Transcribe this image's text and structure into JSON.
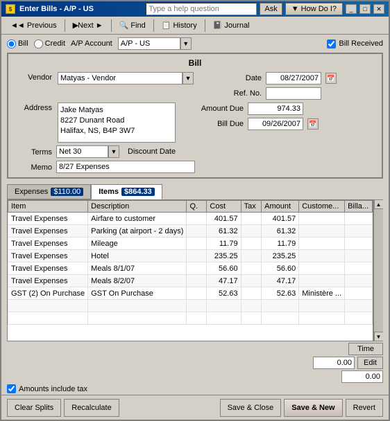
{
  "window": {
    "title": "Enter Bills - A/P - US",
    "help_placeholder": "Type a help question",
    "ask_label": "Ask",
    "howdo_label": "▼ How Do I?"
  },
  "toolbar": {
    "previous_label": "◄ Previous",
    "next_label": "Next ►",
    "find_label": "🔍 Find",
    "history_label": "History",
    "journal_label": "Journal"
  },
  "form": {
    "bill_radio": "Bill",
    "credit_radio": "Credit",
    "ap_account_label": "A/P Account",
    "ap_account_value": "A/P - US",
    "bill_received_label": "Bill Received",
    "section_title": "Bill",
    "vendor_label": "Vendor",
    "vendor_value": "Matyas - Vendor",
    "address_label": "Address",
    "address_line1": "Jake Matyas",
    "address_line2": "8227 Dunant Road",
    "address_line3": "Halifax, NS, B4P 3W7",
    "date_label": "Date",
    "date_value": "08/27/2007",
    "refno_label": "Ref. No.",
    "refno_value": "",
    "amount_due_label": "Amount Due",
    "amount_due_value": "974.33",
    "bill_due_label": "Bill Due",
    "bill_due_value": "09/26/2007",
    "terms_label": "Terms",
    "terms_value": "Net 30",
    "discount_date_label": "Discount Date",
    "memo_label": "Memo",
    "memo_value": "8/27 Expenses"
  },
  "tabs": [
    {
      "label": "Expenses",
      "amount": "$110.00",
      "active": false
    },
    {
      "label": "Items",
      "amount": "$864.33",
      "active": true
    }
  ],
  "table": {
    "headers": [
      "Item",
      "Description",
      "Q.",
      "Cost",
      "Tax",
      "Amount",
      "Custome...",
      "Billa..."
    ],
    "rows": [
      {
        "item": "Travel Expenses",
        "desc": "Airfare to customer",
        "qty": "",
        "cost": "401.57",
        "tax": "",
        "amount": "401.57",
        "customer": "",
        "billable": ""
      },
      {
        "item": "Travel Expenses",
        "desc": "Parking (at airport - 2 days)",
        "qty": "",
        "cost": "61.32",
        "tax": "",
        "amount": "61.32",
        "customer": "",
        "billable": ""
      },
      {
        "item": "Travel Expenses",
        "desc": "Mileage",
        "qty": "",
        "cost": "11.79",
        "tax": "",
        "amount": "11.79",
        "customer": "",
        "billable": ""
      },
      {
        "item": "Travel Expenses",
        "desc": "Hotel",
        "qty": "",
        "cost": "235.25",
        "tax": "",
        "amount": "235.25",
        "customer": "",
        "billable": ""
      },
      {
        "item": "Travel Expenses",
        "desc": "Meals 8/1/07",
        "qty": "",
        "cost": "56.60",
        "tax": "",
        "amount": "56.60",
        "customer": "",
        "billable": ""
      },
      {
        "item": "Travel Expenses",
        "desc": "Meals 8/2/07",
        "qty": "",
        "cost": "47.17",
        "tax": "",
        "amount": "47.17",
        "customer": "",
        "billable": ""
      },
      {
        "item": "GST (2) On Purchase",
        "desc": "GST On Purchase",
        "qty": "",
        "cost": "52.63",
        "tax": "",
        "amount": "52.63",
        "customer": "Ministère ...",
        "billable": ""
      }
    ]
  },
  "bottom": {
    "time_label": "Time",
    "edit_label": "Edit",
    "field1_value": "0.00",
    "field2_value": "0.00",
    "amounts_include_tax_label": "Amounts include tax"
  },
  "footer": {
    "clear_splits_label": "Clear Splits",
    "recalculate_label": "Recalculate",
    "save_close_label": "Save & Close",
    "save_new_label": "Save & New",
    "revert_label": "Revert"
  }
}
